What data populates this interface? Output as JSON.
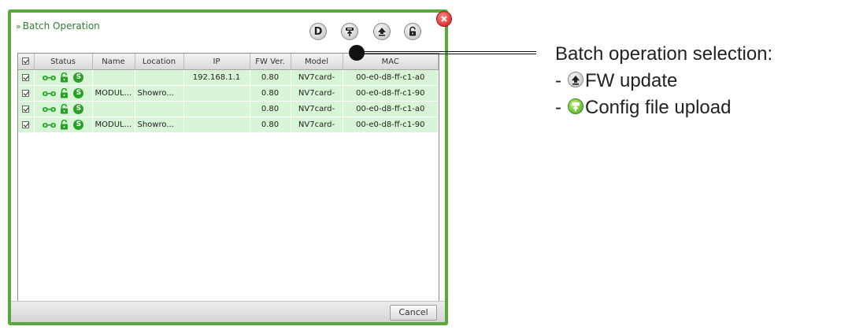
{
  "dialog": {
    "title": "Batch Operation",
    "title_chevron": "»",
    "toolbar": [
      {
        "name": "d-button",
        "letter": "D"
      },
      {
        "name": "config-upload-button"
      },
      {
        "name": "fw-update-button"
      },
      {
        "name": "unlock-button"
      }
    ],
    "table": {
      "columns": [
        "Status",
        "Name",
        "Location",
        "IP",
        "FW Ver.",
        "Model",
        "MAC"
      ],
      "rows": [
        {
          "name": "",
          "location": "",
          "ip": "192.168.1.1",
          "fw": "0.80",
          "model": "NV7card-",
          "mac": "00-e0-d8-ff-c1-a0"
        },
        {
          "name": "MODUL...",
          "location": "Showro...",
          "ip": "",
          "fw": "0.80",
          "model": "NV7card-",
          "mac": "00-e0-d8-ff-c1-90"
        },
        {
          "name": "",
          "location": "",
          "ip": "",
          "fw": "0.80",
          "model": "NV7card-",
          "mac": "00-e0-d8-ff-c1-a0"
        },
        {
          "name": "MODUL...",
          "location": "Showro...",
          "ip": "",
          "fw": "0.80",
          "model": "NV7card-",
          "mac": "00-e0-d8-ff-c1-90"
        }
      ],
      "status_s_letter": "S"
    },
    "cancel_label": "Cancel"
  },
  "annotation": {
    "heading": "Batch operation selection:",
    "items": [
      {
        "dash": "-",
        "label": "FW update",
        "icon": "fw-update-icon"
      },
      {
        "dash": "-",
        "label": "Config file upload",
        "icon": "config-upload-icon"
      }
    ]
  },
  "colors": {
    "dialog_border": "#5aa83a",
    "row_fill": "#d8f5d8",
    "title_text": "#2f7d2f",
    "close_red": "#e23a3a"
  }
}
